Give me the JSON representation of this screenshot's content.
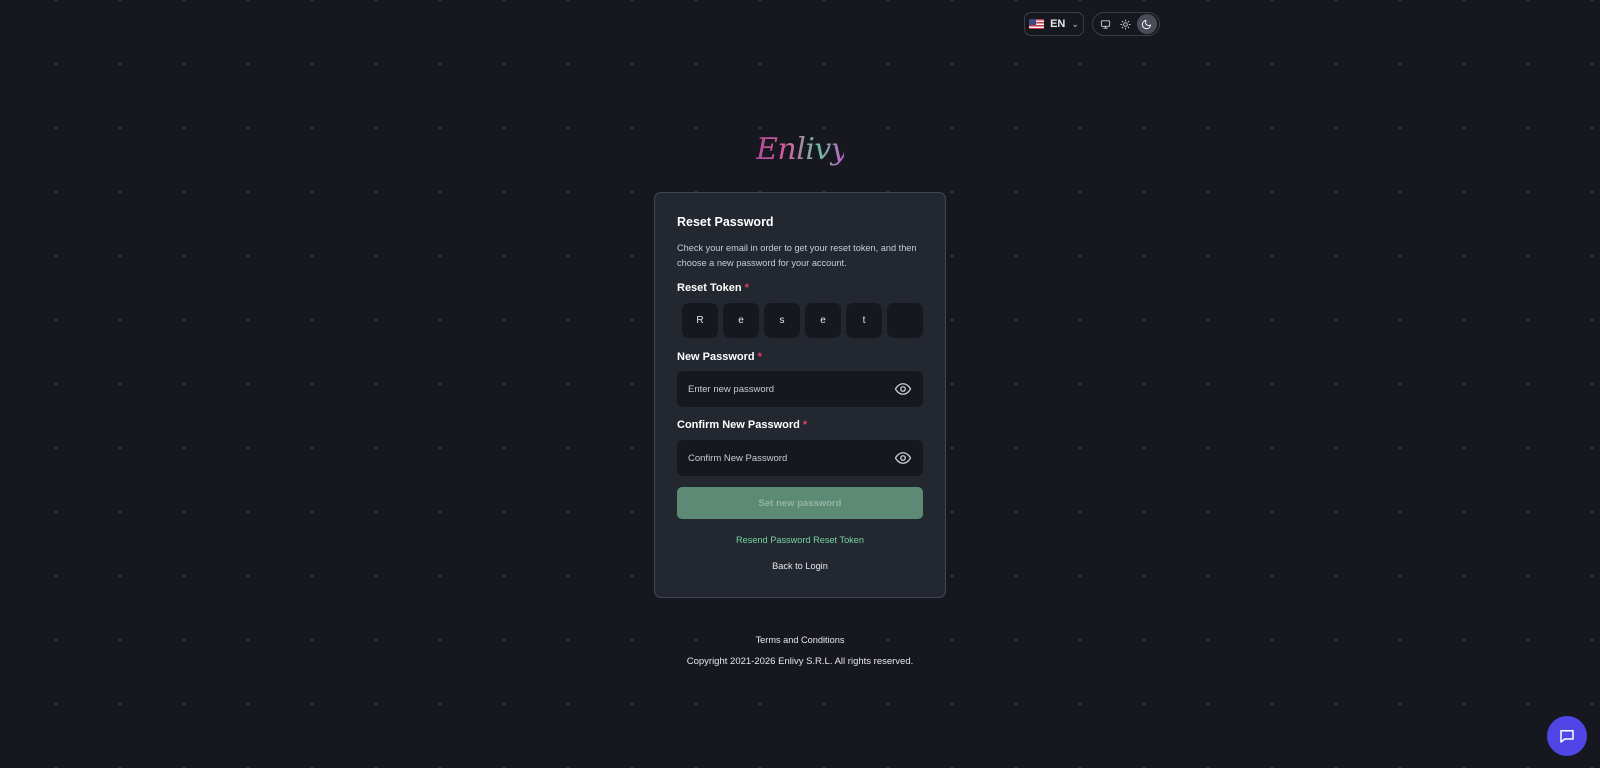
{
  "header": {
    "language": {
      "code": "EN",
      "flag_icon": "us-flag-icon"
    },
    "theme": {
      "options": [
        "system",
        "light",
        "dark"
      ],
      "selected": "dark"
    }
  },
  "brand": {
    "logo_text": "Enlivy"
  },
  "card": {
    "title": "Reset Password",
    "description": "Check your email in order to get your reset token, and then choose a new password for your account.",
    "token": {
      "label": "Reset Token",
      "required_mark": "*",
      "chars": [
        "R",
        "e",
        "s",
        "e",
        "t",
        ""
      ]
    },
    "new_password": {
      "label": "New Password",
      "required_mark": "*",
      "placeholder": "Enter new password"
    },
    "confirm_password": {
      "label": "Confirm New Password",
      "required_mark": "*",
      "placeholder": "Confirm New Password"
    },
    "submit_label": "Set new password",
    "resend_label": "Resend Password Reset Token",
    "back_label": "Back to Login"
  },
  "footer": {
    "terms_label": "Terms and Conditions",
    "copyright": "Copyright 2021-2026 Enlivy S.R.L. All rights reserved."
  },
  "colors": {
    "background": "#17181f",
    "card": "#232730",
    "accent_green": "#74d3a2",
    "button_green": "#5c8a75",
    "required_red": "#e2435a",
    "chat_purple": "#4f46e5"
  }
}
